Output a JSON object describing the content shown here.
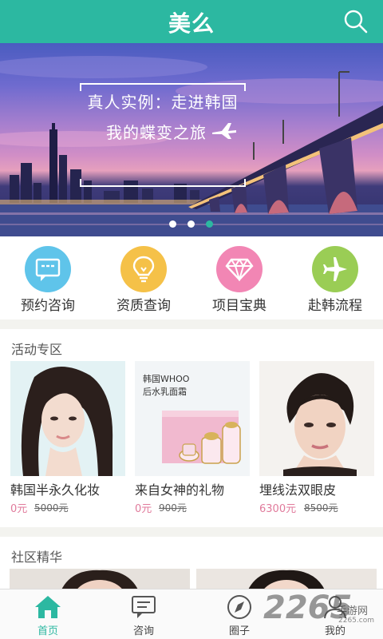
{
  "header": {
    "logo": "美么"
  },
  "banner": {
    "line1": "真人实例：走进韩国",
    "line2": "我的蝶变之旅",
    "dots": 3,
    "active_dot": 3
  },
  "categories": [
    {
      "label": "预约咨询",
      "icon": "chat-bubble-icon",
      "color": "#5fc4ea"
    },
    {
      "label": "资质查询",
      "icon": "lightbulb-icon",
      "color": "#f5c148"
    },
    {
      "label": "项目宝典",
      "icon": "diamond-icon",
      "color": "#f286b4"
    },
    {
      "label": "赴韩流程",
      "icon": "airplane-icon",
      "color": "#9acd55"
    }
  ],
  "activities": {
    "title": "活动专区",
    "items": [
      {
        "name": "韩国半永久化妆",
        "price": "0元",
        "old_price": "5000元"
      },
      {
        "name": "来自女神的礼物",
        "price": "0元",
        "old_price": "900元",
        "img_text1": "韩国WHOO",
        "img_text2": "后水乳面霜"
      },
      {
        "name": "埋线法双眼皮",
        "price": "6300元",
        "old_price": "8500元"
      }
    ]
  },
  "community": {
    "title": "社区精华"
  },
  "tabs": [
    {
      "label": "首页",
      "icon": "home-icon",
      "active": true
    },
    {
      "label": "咨询",
      "icon": "message-icon",
      "active": false
    },
    {
      "label": "圈子",
      "icon": "compass-icon",
      "active": false
    },
    {
      "label": "我的",
      "icon": "user-icon",
      "active": false
    }
  ],
  "watermark": {
    "number": "2265",
    "text": "手游网",
    "url": "2265.com"
  },
  "colors": {
    "brand": "#2cb8a1",
    "price": "#e07a9b"
  }
}
